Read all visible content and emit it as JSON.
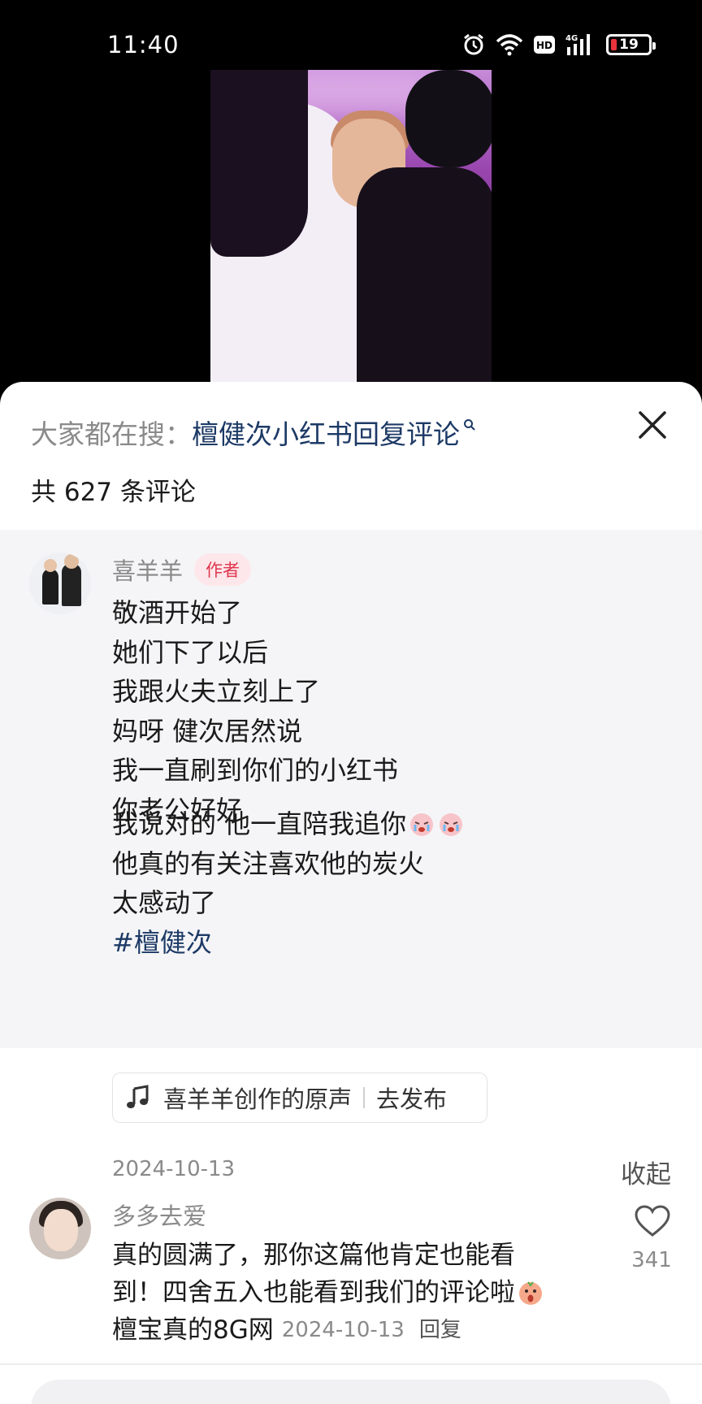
{
  "status_bar": {
    "time": "11:40",
    "battery_level": "19",
    "icons": [
      "alarm-icon",
      "wifi-icon",
      "hd-icon",
      "signal-4g-icon",
      "battery-icon"
    ]
  },
  "sheet": {
    "search_prefix": "大家都在搜：",
    "search_term": "檀健次小红书回复评论",
    "comment_count": "共 627 条评论"
  },
  "pinned_comment": {
    "author": "喜羊羊",
    "badge": "作者",
    "lines_a": [
      "敬酒开始了",
      "她们下了以后",
      "我跟火夫立刻上了",
      "妈呀 健次居然说",
      "我一直刷到你们的小红书",
      "你老公好好"
    ],
    "line_b1": "我说对的 他一直陪我追你",
    "line_b2": "他真的有关注喜欢他的炭火",
    "line_b3": "太感动了",
    "hashtag": "#檀健次",
    "music_label": "喜羊羊创作的原声",
    "music_action": "去发布",
    "date": "2024-10-13",
    "collapse_label": "收起"
  },
  "comment2": {
    "author": "多多去爱",
    "line1": "真的圆满了，那你这篇他肯定也能看",
    "line2": "到！四舍五入也能看到我们的评论啦",
    "line3": "檀宝真的8G网",
    "date": "2024-10-13",
    "reply_label": "回复",
    "likes": "341"
  },
  "colors": {
    "accent_link": "#1d3a66",
    "author_badge": "#e0364e",
    "pinned_bg": "#f5f5f7"
  }
}
